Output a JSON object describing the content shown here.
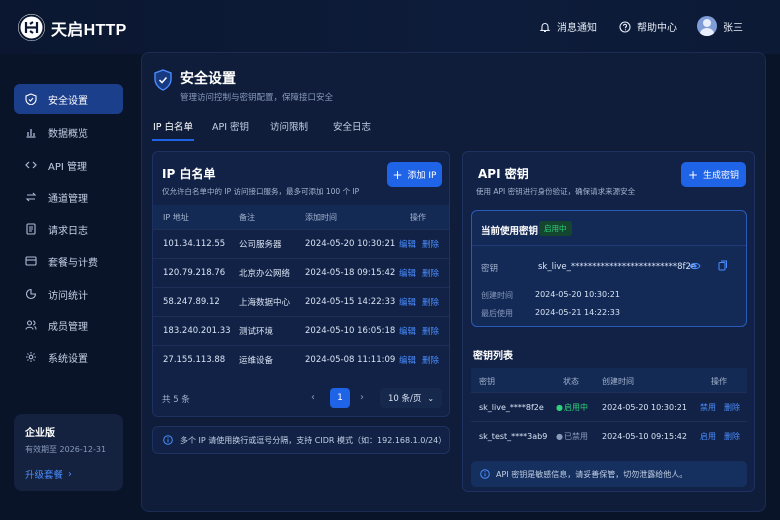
{
  "app": {
    "name": "天启HTTP"
  },
  "topbar": {
    "notify": "消息通知",
    "help": "帮助中心",
    "user": "张三"
  },
  "sidebar": {
    "items": [
      {
        "label": "安全设置",
        "icon": "shield-icon"
      },
      {
        "label": "数据概览",
        "icon": "bar-chart-icon"
      },
      {
        "label": "API 管理",
        "icon": "api-icon"
      },
      {
        "label": "通道管理",
        "icon": "channel-icon"
      },
      {
        "label": "请求日志",
        "icon": "log-icon"
      },
      {
        "label": "套餐与计费",
        "icon": "billing-icon"
      },
      {
        "label": "访问统计",
        "icon": "stats-icon"
      },
      {
        "label": "成员管理",
        "icon": "users-icon"
      },
      {
        "label": "系统设置",
        "icon": "gear-icon"
      }
    ],
    "plan": {
      "name": "企业版",
      "expiry": "有效期至 2026-12-31",
      "upgrade": "升级套餐"
    }
  },
  "page": {
    "title": "安全设置",
    "subtitle": "管理访问控制与密钥配置，保障接口安全",
    "tabs": [
      "IP 白名单",
      "API 密钥",
      "访问限制",
      "安全日志"
    ]
  },
  "whitelist": {
    "title": "IP 白名单",
    "desc": "仅允许白名单中的 IP 访问接口服务，最多可添加 100 个 IP",
    "add_button": "添加 IP",
    "columns": [
      "IP 地址",
      "备注",
      "添加时间",
      "操作"
    ],
    "edit": "编辑",
    "delete": "删除",
    "rows": [
      {
        "ip": "101.34.112.55",
        "note": "公司服务器",
        "time": "2024-05-20 10:30:21"
      },
      {
        "ip": "120.79.218.76",
        "note": "北京办公网络",
        "time": "2024-05-18 09:15:42"
      },
      {
        "ip": "58.247.89.12",
        "note": "上海数据中心",
        "time": "2024-05-15 14:22:33"
      },
      {
        "ip": "183.240.201.33",
        "note": "测试环境",
        "time": "2024-05-10 16:05:18"
      },
      {
        "ip": "27.155.113.88",
        "note": "运维设备",
        "time": "2024-05-08 11:11:09"
      }
    ],
    "total": "共 5 条",
    "current_page": "1",
    "page_size": "10 条/页",
    "tip": "多个 IP 请使用换行或逗号分隔，支持 CIDR 模式（如：192.168.1.0/24）"
  },
  "apikey": {
    "title": "API 密钥",
    "desc": "使用 API 密钥进行身份验证，确保请求来源安全",
    "gen_button": "生成密钥",
    "current": {
      "title": "当前使用密钥",
      "badge": "启用中",
      "key_label": "密钥",
      "key_value": "sk_live_*************************8f2e",
      "created_label": "创建时间",
      "created": "2024-05-20 10:30:21",
      "last_label": "最后使用",
      "last": "2024-05-21 14:22:33"
    },
    "list": {
      "title": "密钥列表",
      "columns": [
        "密钥",
        "状态",
        "创建时间",
        "操作"
      ],
      "rows": [
        {
          "key": "sk_live_****8f2e",
          "status": "启用中",
          "time": "2024-05-20 10:30:21",
          "a1": "禁用",
          "a2": "删除"
        },
        {
          "key": "sk_test_****3ab9",
          "status": "已禁用",
          "time": "2024-05-10 09:15:42",
          "a1": "启用",
          "a2": "删除"
        }
      ]
    },
    "warning": "API 密钥是敏感信息，请妥善保管，切勿泄露给他人。"
  },
  "colors": {
    "accent": "#1f63e6",
    "success": "#2fd27a",
    "link": "#4a8dff",
    "bg": "#0a1428"
  }
}
